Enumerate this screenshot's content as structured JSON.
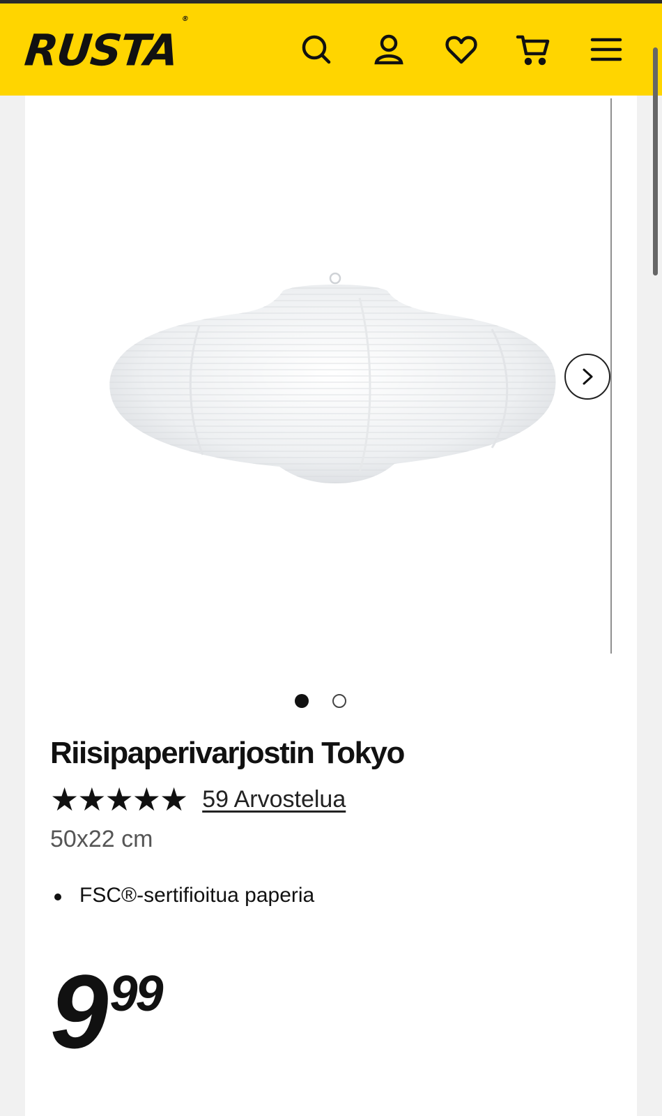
{
  "header": {
    "logo": "RUSTA",
    "logo_mark": "®",
    "icons": [
      "search-icon",
      "account-icon",
      "heart-icon",
      "cart-icon",
      "menu-icon"
    ],
    "brand_color": "#ffd500"
  },
  "gallery": {
    "next_icon": "chevron-right-icon",
    "slides_total": 2,
    "active_slide": 1
  },
  "product": {
    "title": "Riisipaperivarjostin Tokyo",
    "stars": "★★★★★",
    "rating": 5,
    "reviews_link": "59 Arvostelua",
    "size": "50x22 cm",
    "features": [
      "FSC®-sertifioitua paperia"
    ],
    "price_integer": "9",
    "price_decimal": "99"
  }
}
